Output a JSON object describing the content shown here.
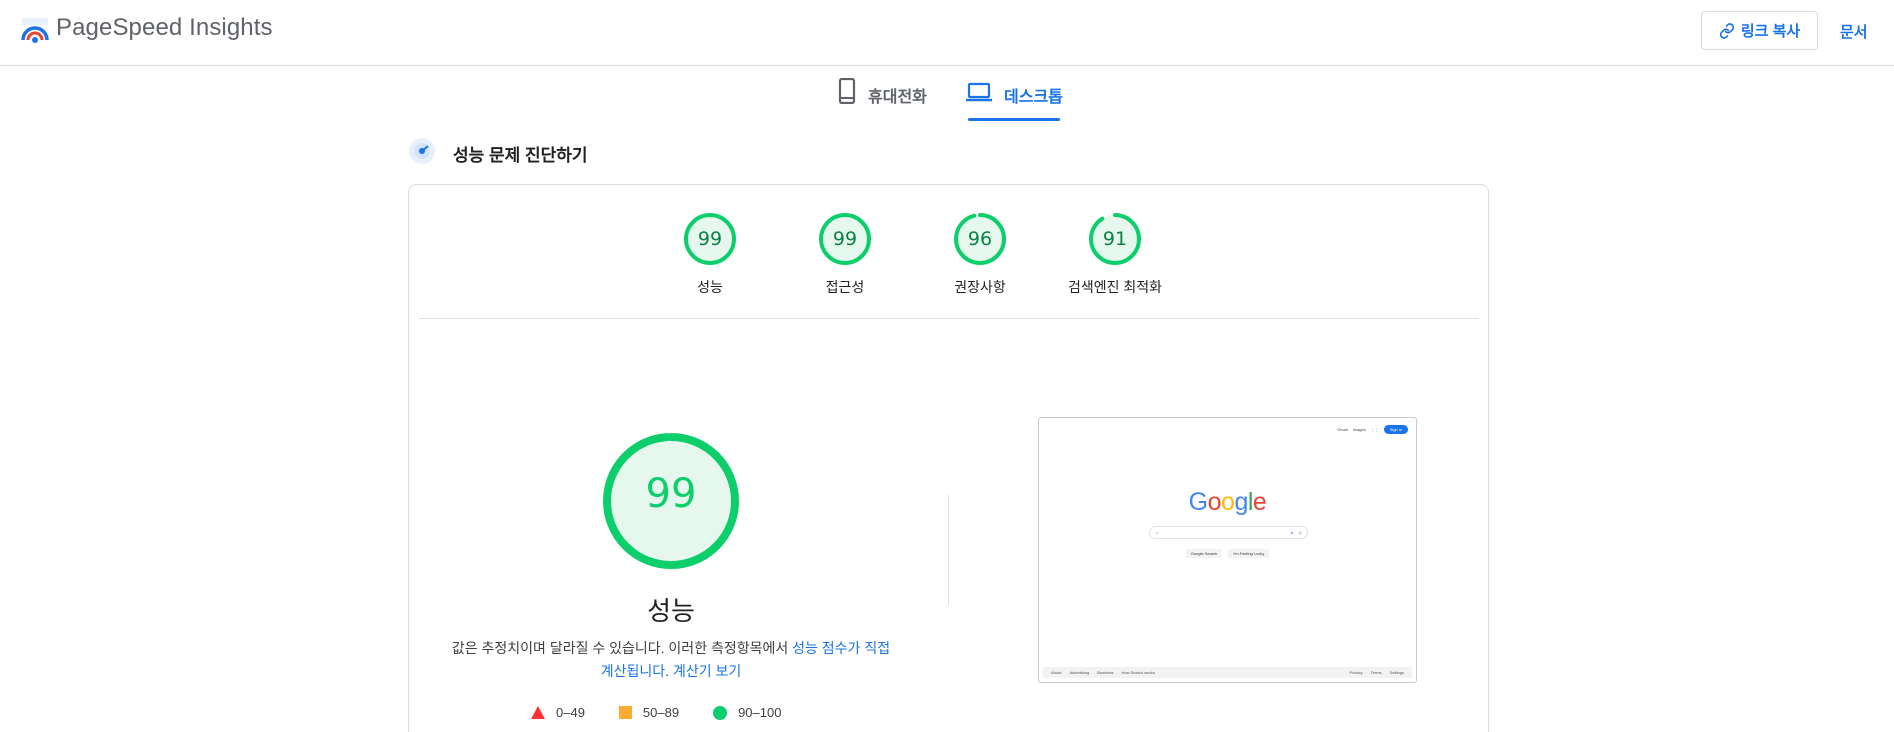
{
  "header": {
    "app_title": "PageSpeed Insights",
    "copy_link_label": "링크 복사",
    "docs_label": "문서"
  },
  "tabs": [
    {
      "label": "휴대전화",
      "icon": "smartphone-icon",
      "active": false
    },
    {
      "label": "데스크톱",
      "icon": "laptop-icon",
      "active": true
    }
  ],
  "section": {
    "title": "성능 문제 진단하기"
  },
  "categories": [
    {
      "label": "성능",
      "score": 99
    },
    {
      "label": "접근성",
      "score": 99
    },
    {
      "label": "권장사항",
      "score": 96
    },
    {
      "label": "검색엔진 최적화",
      "score": 91
    }
  ],
  "main_score": {
    "score": 99,
    "label": "성능",
    "note_prefix": "값은 추정치이며 달라질 수 있습니다. 이러한 측정항목에서 ",
    "note_link1": "성능 점수가 직접 계산됩니다",
    "note_mid": ". ",
    "note_link2": "계산기 보기"
  },
  "legend": [
    {
      "label": "0–49",
      "shape": "triangle",
      "color": "#ff3333"
    },
    {
      "label": "50–89",
      "shape": "square",
      "color": "#ffaa33"
    },
    {
      "label": "90–100",
      "shape": "circle",
      "color": "#0cce6b"
    }
  ],
  "screenshot": {
    "top_links": [
      "Gmail",
      "Images"
    ],
    "sign_in": "Sign in",
    "logo_text": "Google",
    "buttons": [
      "Google Search",
      "I'm Feeling Lucky"
    ],
    "footer_left": [
      "About",
      "Advertising",
      "Business",
      "How Search works"
    ],
    "footer_right": [
      "Privacy",
      "Terms",
      "Settings"
    ]
  },
  "colors": {
    "pass_green": "#0cce6b",
    "pass_text": "#0b8043",
    "accent_blue": "#1a73e8"
  }
}
